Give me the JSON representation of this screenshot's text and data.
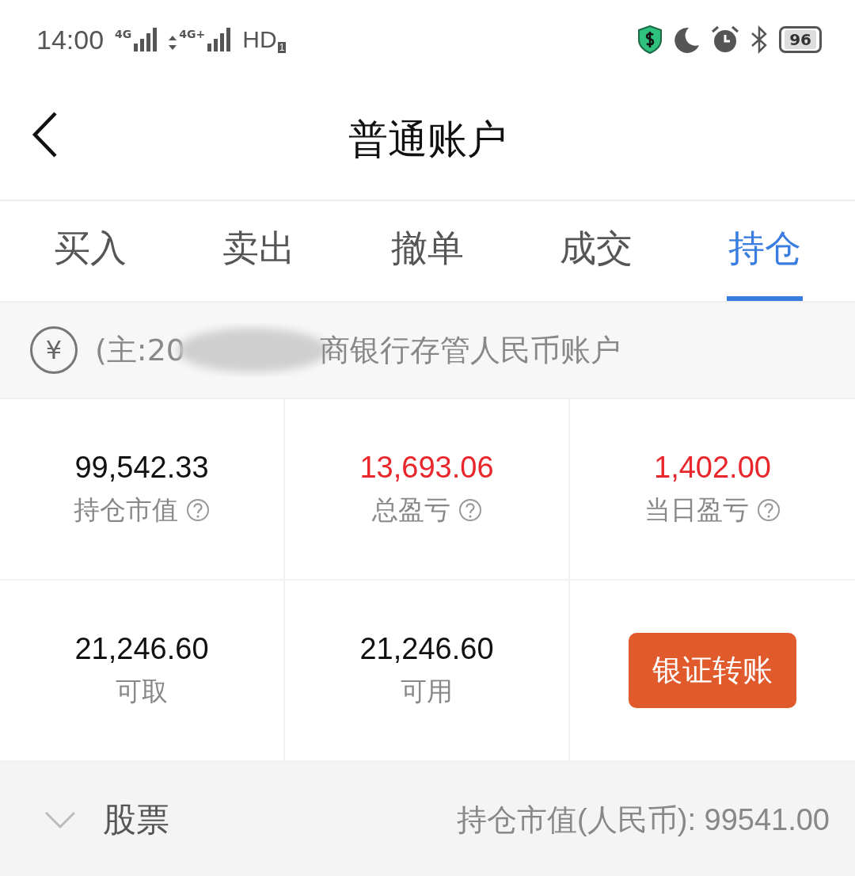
{
  "status_bar": {
    "time": "14:00",
    "sim1": "4G",
    "sim2": "4G+",
    "hd": "HD",
    "hd_sub": "1",
    "battery": "96"
  },
  "header": {
    "title": "普通账户"
  },
  "tabs": [
    {
      "label": "买入",
      "selected": false
    },
    {
      "label": "卖出",
      "selected": false
    },
    {
      "label": "撤单",
      "selected": false
    },
    {
      "label": "成交",
      "selected": false
    },
    {
      "label": "持仓",
      "selected": true
    }
  ],
  "account": {
    "currency_symbol": "¥",
    "prefix": "(主:20",
    "suffix": "商银行存管人民币账户",
    "redacted": true
  },
  "stats": [
    {
      "kind": "value",
      "value": "99,542.33",
      "label": "持仓市值",
      "help": true,
      "color": "#111111"
    },
    {
      "kind": "value",
      "value": "13,693.06",
      "label": "总盈亏",
      "help": true,
      "color": "#e8262b"
    },
    {
      "kind": "value",
      "value": "1,402.00",
      "label": "当日盈亏",
      "help": true,
      "color": "#e8262b"
    },
    {
      "kind": "value",
      "value": "21,246.60",
      "label": "可取",
      "help": false,
      "color": "#111111"
    },
    {
      "kind": "value",
      "value": "21,246.60",
      "label": "可用",
      "help": false,
      "color": "#111111"
    },
    {
      "kind": "button",
      "label": "银证转账"
    }
  ],
  "section": {
    "label": "股票",
    "expanded": false,
    "summary": "持仓市值(人民币): 99541.00"
  }
}
